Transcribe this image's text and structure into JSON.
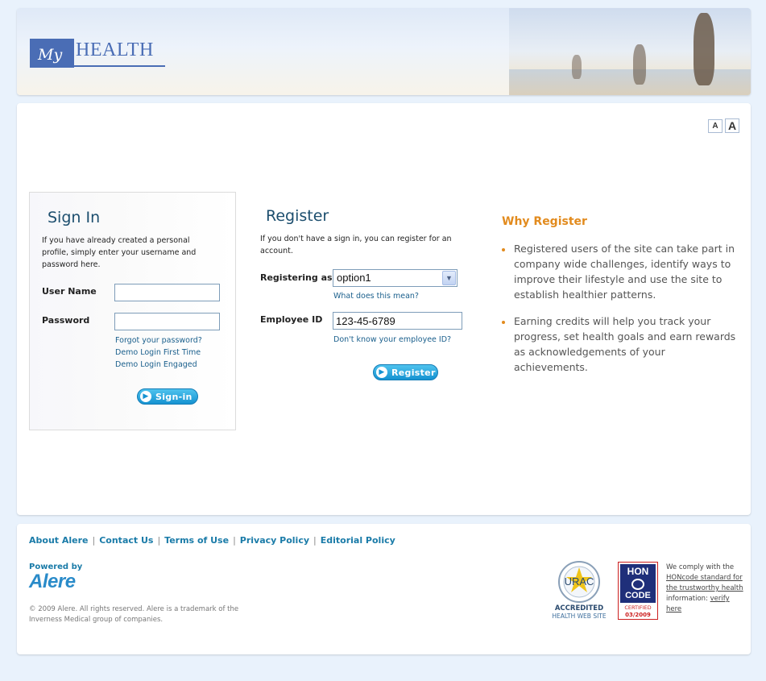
{
  "header": {
    "logo_my": "My",
    "logo_health": "HEALTH"
  },
  "font_size": {
    "small": "A",
    "large": "A"
  },
  "signin": {
    "title": "Sign In",
    "intro": "If you have already created a personal profile, simply enter your username and password here.",
    "username_label": "User Name",
    "password_label": "Password",
    "username_value": "",
    "password_value": "",
    "links": [
      "Forgot your password?",
      "Demo Login First Time",
      "Demo Login Engaged"
    ],
    "button_label": "Sign-in"
  },
  "register": {
    "title": "Register",
    "intro": "If you don't have a sign in, you can register for an account.",
    "registering_label": "Registering as",
    "registering_value": "option1",
    "registering_help": "What does this mean?",
    "employee_label": "Employee ID",
    "employee_value": "123-45-6789",
    "employee_help": "Don't know your employee ID?",
    "button_label": "Register"
  },
  "why": {
    "title": "Why Register",
    "points": [
      "Registered users of the site can take part in company wide challenges, identify ways to improve their lifestyle and use the site to establish healthier patterns.",
      "Earning credits will help you track your progress, set health goals and earn rewards as acknowledgements of your achievements."
    ]
  },
  "footer": {
    "links": [
      "About Alere",
      "Contact Us",
      "Terms of Use",
      "Privacy Policy",
      "Editorial Policy"
    ],
    "powered_by": "Powered by",
    "brand": "Alere",
    "copyright": "© 2009 Alere. All rights reserved. Alere is a trademark of the Inverness Medical group of companies.",
    "urac": {
      "name": "URAC",
      "line1": "ACCREDITED",
      "line2": "HEALTH WEB SITE"
    },
    "hon": {
      "top": "HON",
      "mid": "CODE",
      "certified": "CERTIFIED",
      "date": "03/2009"
    },
    "honcode_prefix": "We comply with the ",
    "honcode_link": "HONcode standard for the trustworthy health",
    "honcode_mid": " information: ",
    "honcode_verify": "verify here"
  }
}
